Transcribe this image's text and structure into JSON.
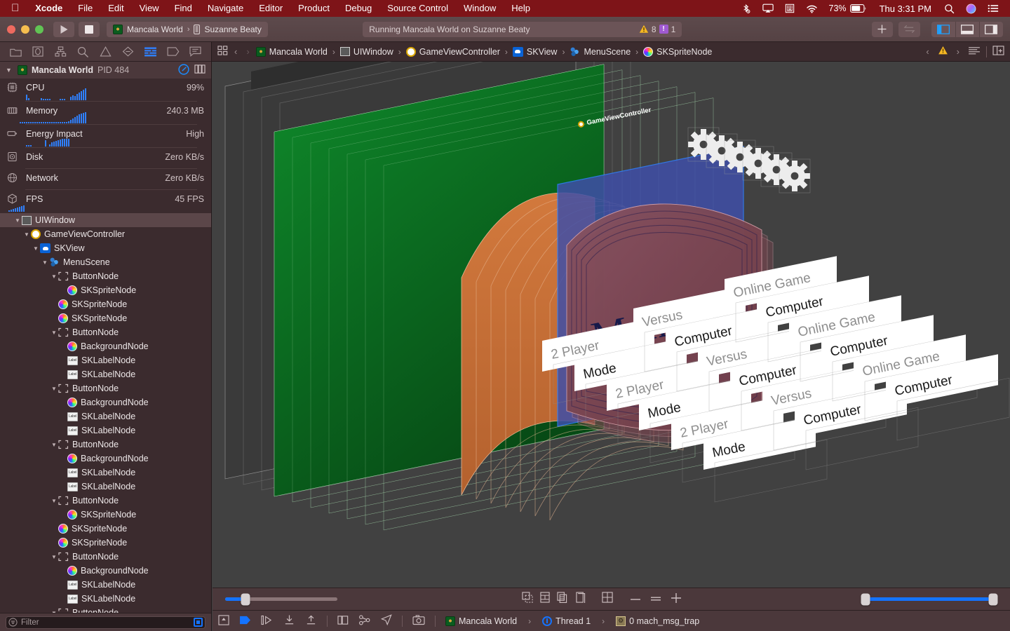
{
  "menubar": {
    "apple_icon": "apple-logo-icon",
    "items": [
      {
        "label": "Xcode",
        "bold": true
      },
      {
        "label": "File",
        "bold": false
      },
      {
        "label": "Edit",
        "bold": false
      },
      {
        "label": "View",
        "bold": false
      },
      {
        "label": "Find",
        "bold": false
      },
      {
        "label": "Navigate",
        "bold": false
      },
      {
        "label": "Editor",
        "bold": false
      },
      {
        "label": "Product",
        "bold": false
      },
      {
        "label": "Debug",
        "bold": false
      },
      {
        "label": "Source Control",
        "bold": false
      },
      {
        "label": "Window",
        "bold": false
      },
      {
        "label": "Help",
        "bold": false
      }
    ],
    "status": {
      "bluetooth_icon": "bluetooth-disabled-icon",
      "airplay_icon": "airplay-icon",
      "keyboard_icon": "keyboard-viewer-icon",
      "wifi_icon": "wifi-icon",
      "battery_percent": "73%",
      "battery_icon": "battery-icon",
      "clock": "Thu 3:31 PM",
      "search_icon": "spotlight-search-icon",
      "siri_icon": "siri-icon",
      "controlcenter_icon": "notification-center-icon"
    },
    "bg_color": "#7e1418"
  },
  "toolbar": {
    "run_icon": "run-play-icon",
    "stop_icon": "stop-square-icon",
    "scheme": {
      "project": "Mancala World",
      "separator": "›",
      "device": "Suzanne Beaty",
      "device_icon": "iphone-device-icon",
      "app_icon": "mancala-app-icon"
    },
    "status_text": "Running Mancala World on Suzanne Beaty",
    "warning_count": "8",
    "error_count": "1",
    "add_icon": "plus-icon",
    "swap_icon": "swap-arrows-icon",
    "panel_left_icon": "toggle-navigator-icon",
    "panel_bottom_icon": "toggle-debug-area-icon",
    "panel_right_icon": "toggle-inspector-icon",
    "accent_color": "#1473ff"
  },
  "navigator": {
    "tabs": [
      {
        "name": "project-navigator",
        "icon": "folder-icon",
        "active": false
      },
      {
        "name": "source-control-navigator",
        "icon": "source-control-icon",
        "active": false
      },
      {
        "name": "symbol-navigator",
        "icon": "symbol-hierarchy-icon",
        "active": false
      },
      {
        "name": "find-navigator",
        "icon": "search-icon",
        "active": false
      },
      {
        "name": "issue-navigator",
        "icon": "warning-triangle-icon",
        "active": false
      },
      {
        "name": "test-navigator",
        "icon": "diamond-icon",
        "active": false
      },
      {
        "name": "debug-navigator",
        "icon": "debug-gauge-icon",
        "active": true
      },
      {
        "name": "breakpoint-navigator",
        "icon": "breakpoint-tag-icon",
        "active": false
      },
      {
        "name": "report-navigator",
        "icon": "report-speech-icon",
        "active": false
      }
    ],
    "process": {
      "name": "Mancala World",
      "pid": "PID 484",
      "gauge_icon": "gauge-meter-icon",
      "hierarchy_icon": "view-hierarchy-icon"
    },
    "gauges": [
      {
        "label": "CPU",
        "value": "99%",
        "icon": "cpu-icon",
        "spark": [
          0,
          0,
          0,
          8,
          3,
          0,
          0,
          0,
          0,
          0,
          3,
          2,
          2,
          2,
          2,
          0,
          0,
          0,
          0,
          2,
          2,
          2,
          0,
          0,
          5,
          7,
          6,
          9,
          11,
          13,
          15,
          17
        ]
      },
      {
        "label": "Memory",
        "value": "240.3 MB",
        "icon": "memory-icon",
        "spark": [
          2,
          2,
          2,
          2,
          2,
          2,
          2,
          2,
          2,
          2,
          2,
          2,
          2,
          2,
          2,
          2,
          2,
          2,
          2,
          2,
          2,
          2,
          2,
          3,
          5,
          7,
          9,
          11,
          13,
          14,
          15,
          16
        ]
      },
      {
        "label": "Energy Impact",
        "value": "High",
        "icon": "energy-icon",
        "spark": [
          0,
          0,
          0,
          2,
          2,
          2,
          0,
          0,
          0,
          0,
          0,
          0,
          9,
          0,
          3,
          6,
          7,
          8,
          9,
          10,
          11,
          11,
          11,
          11,
          0,
          0,
          0,
          0,
          0,
          0,
          0,
          0
        ]
      },
      {
        "label": "Disk",
        "value": "Zero KB/s",
        "icon": "disk-icon",
        "spark": []
      },
      {
        "label": "Network",
        "value": "Zero KB/s",
        "icon": "network-icon",
        "spark": []
      },
      {
        "label": "FPS",
        "value": "45 FPS",
        "icon": "fps-cube-icon",
        "spark": [
          2,
          3,
          4,
          5,
          6,
          7,
          8,
          9
        ]
      }
    ],
    "tree": [
      {
        "label": "UIWindow",
        "depth": 1,
        "icon": "uiwindow-icon",
        "arrow": true,
        "selected": true
      },
      {
        "label": "GameViewController",
        "depth": 2,
        "icon": "viewcontroller-icon",
        "arrow": true,
        "selected": false
      },
      {
        "label": "SKView",
        "depth": 3,
        "icon": "skview-icon",
        "arrow": true,
        "selected": false
      },
      {
        "label": "MenuScene",
        "depth": 4,
        "icon": "scene-icon",
        "arrow": true,
        "selected": false
      },
      {
        "label": "ButtonNode",
        "depth": 5,
        "icon": "buttonnode-icon",
        "arrow": true,
        "selected": false
      },
      {
        "label": "SKSpriteNode",
        "depth": 6,
        "icon": "sprite-icon",
        "arrow": false,
        "selected": false
      },
      {
        "label": "SKSpriteNode",
        "depth": 5,
        "icon": "sprite-icon",
        "arrow": false,
        "selected": false
      },
      {
        "label": "SKSpriteNode",
        "depth": 5,
        "icon": "sprite-icon",
        "arrow": false,
        "selected": false
      },
      {
        "label": "ButtonNode",
        "depth": 5,
        "icon": "buttonnode-icon",
        "arrow": true,
        "selected": false
      },
      {
        "label": "BackgroundNode",
        "depth": 6,
        "icon": "sprite-icon",
        "arrow": false,
        "selected": false
      },
      {
        "label": "SKLabelNode",
        "depth": 6,
        "icon": "label-icon",
        "arrow": false,
        "selected": false
      },
      {
        "label": "SKLabelNode",
        "depth": 6,
        "icon": "label-icon",
        "arrow": false,
        "selected": false
      },
      {
        "label": "ButtonNode",
        "depth": 5,
        "icon": "buttonnode-icon",
        "arrow": true,
        "selected": false
      },
      {
        "label": "BackgroundNode",
        "depth": 6,
        "icon": "sprite-icon",
        "arrow": false,
        "selected": false
      },
      {
        "label": "SKLabelNode",
        "depth": 6,
        "icon": "label-icon",
        "arrow": false,
        "selected": false
      },
      {
        "label": "SKLabelNode",
        "depth": 6,
        "icon": "label-icon",
        "arrow": false,
        "selected": false
      },
      {
        "label": "ButtonNode",
        "depth": 5,
        "icon": "buttonnode-icon",
        "arrow": true,
        "selected": false
      },
      {
        "label": "BackgroundNode",
        "depth": 6,
        "icon": "sprite-icon",
        "arrow": false,
        "selected": false
      },
      {
        "label": "SKLabelNode",
        "depth": 6,
        "icon": "label-icon",
        "arrow": false,
        "selected": false
      },
      {
        "label": "SKLabelNode",
        "depth": 6,
        "icon": "label-icon",
        "arrow": false,
        "selected": false
      },
      {
        "label": "ButtonNode",
        "depth": 5,
        "icon": "buttonnode-icon",
        "arrow": true,
        "selected": false
      },
      {
        "label": "SKSpriteNode",
        "depth": 6,
        "icon": "sprite-icon",
        "arrow": false,
        "selected": false
      },
      {
        "label": "SKSpriteNode",
        "depth": 5,
        "icon": "sprite-icon",
        "arrow": false,
        "selected": false
      },
      {
        "label": "SKSpriteNode",
        "depth": 5,
        "icon": "sprite-icon",
        "arrow": false,
        "selected": false
      },
      {
        "label": "ButtonNode",
        "depth": 5,
        "icon": "buttonnode-icon",
        "arrow": true,
        "selected": false
      },
      {
        "label": "BackgroundNode",
        "depth": 6,
        "icon": "sprite-icon",
        "arrow": false,
        "selected": false
      },
      {
        "label": "SKLabelNode",
        "depth": 6,
        "icon": "label-icon",
        "arrow": false,
        "selected": false
      },
      {
        "label": "SKLabelNode",
        "depth": 6,
        "icon": "label-icon",
        "arrow": false,
        "selected": false
      },
      {
        "label": "ButtonNode",
        "depth": 5,
        "icon": "buttonnode-icon",
        "arrow": true,
        "selected": false
      }
    ],
    "filter": {
      "placeholder": "Filter",
      "icon": "filter-icon",
      "scope_icon": "filter-scope-icon"
    }
  },
  "jumpbar": {
    "grid_icon": "related-items-icon",
    "back_icon": "chevron-left-icon",
    "forward_icon": "chevron-right-icon",
    "crumbs": [
      {
        "label": "Mancala World",
        "icon": "mancala-app-icon"
      },
      {
        "label": "UIWindow",
        "icon": "uiwindow-icon"
      },
      {
        "label": "GameViewController",
        "icon": "viewcontroller-icon"
      },
      {
        "label": "SKView",
        "icon": "skview-icon"
      },
      {
        "label": "MenuScene",
        "icon": "scene-icon"
      },
      {
        "label": "SKSpriteNode",
        "icon": "sprite-icon"
      }
    ],
    "separator": "›",
    "warn_icon": "warning-triangle-icon",
    "list_icon": "list-lines-icon",
    "add_editor_icon": "add-editor-icon"
  },
  "canvas": {
    "background_color": "#414141",
    "vc_label": "GameViewController",
    "scene_title": "Mancala",
    "gear_count": 6,
    "gear_icon": "gear-sprite-icon",
    "button_labels": [
      "2 Player",
      "Versus",
      "Online Game",
      "Computer",
      "Mode"
    ],
    "layer_colors": {
      "scene_green": "#0b6b22",
      "sign_wood": "#7e4a55",
      "wave_orange": "#c8703a",
      "selected_blue": "#3f4fa8",
      "window_gray": "#3a3a3a"
    },
    "selection_color": "#2f80ff"
  },
  "view_debug_bar": {
    "spacing_slider": {
      "value": 18,
      "icon": "layer-spacing-slider"
    },
    "buttons": [
      {
        "name": "show-clipped-content",
        "icon": "clipped-content-icon"
      },
      {
        "name": "show-constraints",
        "icon": "constraints-icon"
      },
      {
        "name": "show-layers",
        "icon": "layers-icon"
      },
      {
        "name": "show-view-frames",
        "icon": "view-frames-icon"
      },
      {
        "name": "orient-to-3d",
        "icon": "grid-orientation-icon"
      }
    ],
    "zoom_out_icon": "zoom-out-minus-icon",
    "zoom_reset_icon": "zoom-actual-size-icon",
    "zoom_in_icon": "zoom-in-plus-icon",
    "zoom_slider": {
      "value": 100,
      "icon": "zoom-range-slider"
    }
  },
  "debug_bar": {
    "hide_icon": "hide-debug-area-icon",
    "continue_icon": "continue-execution-icon",
    "step_over_icon": "step-over-icon",
    "step_into_icon": "step-into-icon",
    "step_out_icon": "step-out-icon",
    "view_hierarchy_icon": "debug-view-hierarchy-icon",
    "memory_graph_icon": "memory-graph-icon",
    "location_icon": "simulate-location-icon",
    "screenshot_icon": "take-screenshot-icon",
    "process": "Mancala World",
    "process_icon": "mancala-app-icon",
    "thread": "Thread 1",
    "thread_icon": "thread-icon",
    "frame": "0 mach_msg_trap",
    "frame_icon": "stack-frame-icon",
    "separator": "›"
  }
}
